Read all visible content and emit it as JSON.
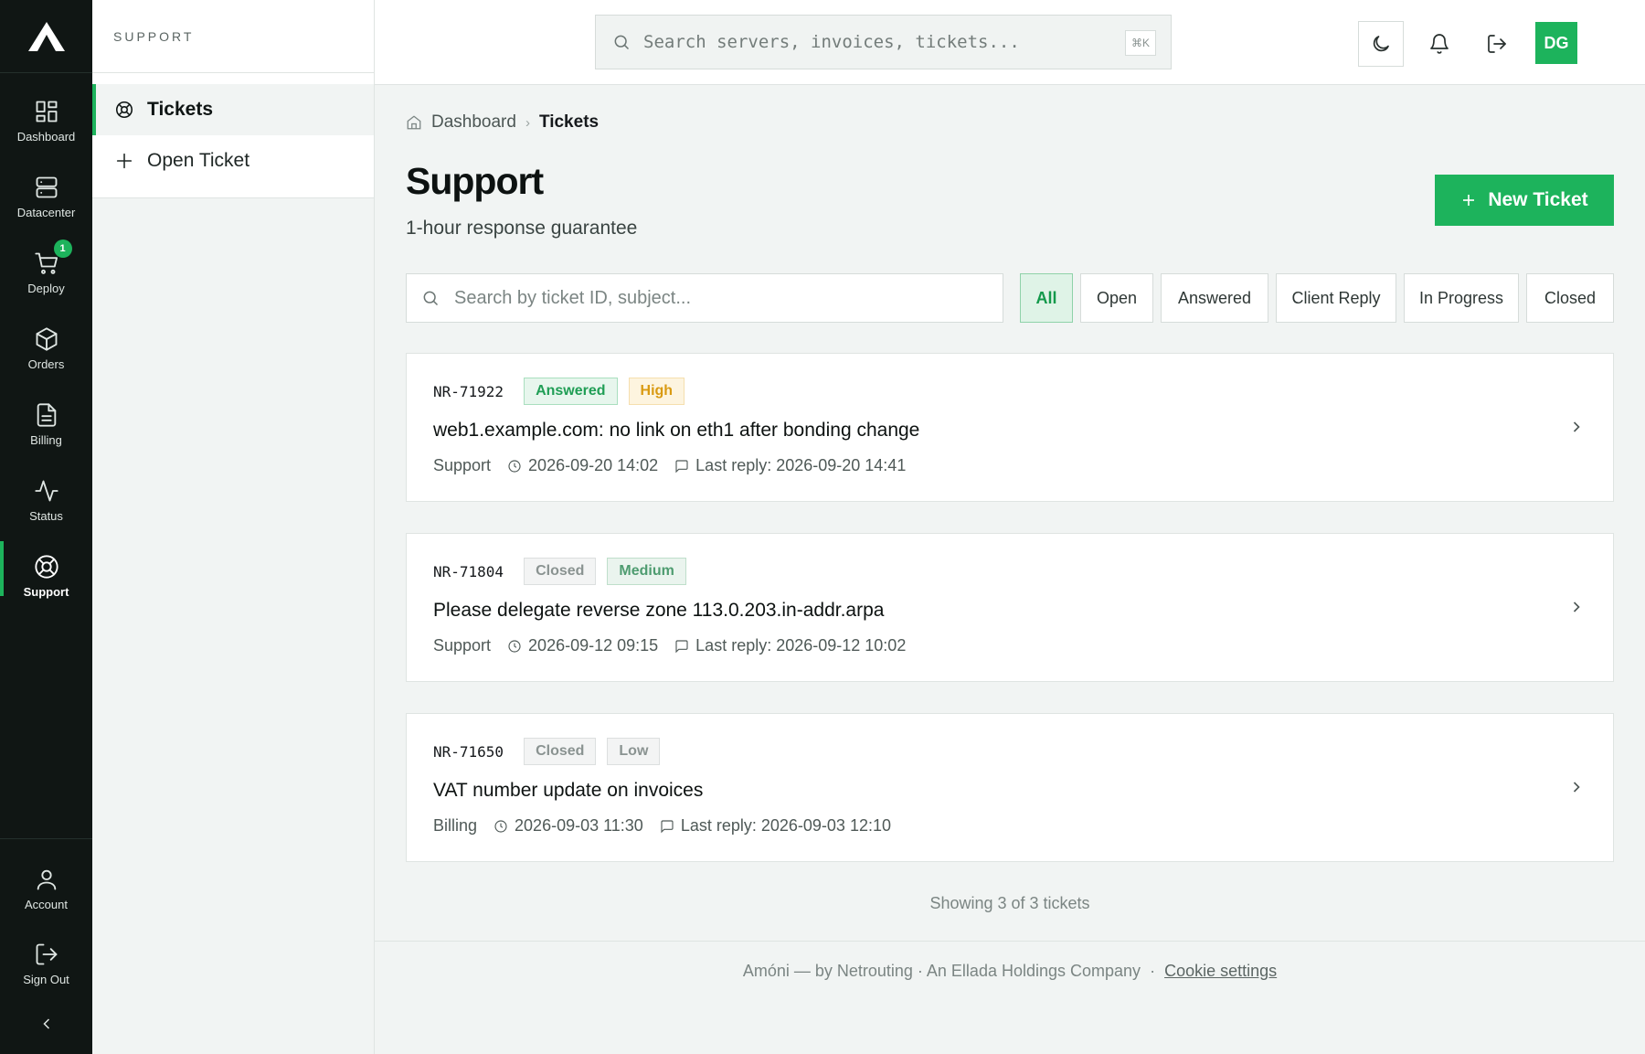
{
  "rail": {
    "items": [
      {
        "label": "Dashboard"
      },
      {
        "label": "Datacenter"
      },
      {
        "label": "Deploy",
        "badge": "1"
      },
      {
        "label": "Orders"
      },
      {
        "label": "Billing"
      },
      {
        "label": "Status"
      },
      {
        "label": "Support",
        "active": true
      }
    ],
    "bottom": [
      {
        "label": "Account"
      },
      {
        "label": "Sign Out"
      }
    ]
  },
  "subnav": {
    "heading": "SUPPORT",
    "items": [
      {
        "label": "Tickets",
        "active": true
      },
      {
        "label": "Open Ticket"
      }
    ]
  },
  "topbar": {
    "search_placeholder": "Search servers, invoices, tickets...",
    "shortcut": "⌘K",
    "avatar_initials": "DG"
  },
  "breadcrumb": {
    "home": "Dashboard",
    "separator": "›",
    "current": "Tickets"
  },
  "page": {
    "title": "Support",
    "subtitle": "1-hour response guarantee",
    "new_ticket_label": "New Ticket",
    "search_placeholder": "Search by ticket ID, subject..."
  },
  "filters": [
    "All",
    "Open",
    "Answered",
    "Client Reply",
    "In Progress",
    "Closed"
  ],
  "tickets": [
    {
      "id": "NR-71922",
      "status": "Answered",
      "priority": "High",
      "subject": "web1.example.com: no link on eth1 after bonding change",
      "department": "Support",
      "created": "2026-09-20 14:02",
      "last_reply": "Last reply: 2026-09-20 14:41"
    },
    {
      "id": "NR-71804",
      "status": "Closed",
      "priority": "Medium",
      "subject": "Please delegate reverse zone 113.0.203.in-addr.arpa",
      "department": "Support",
      "created": "2026-09-12 09:15",
      "last_reply": "Last reply: 2026-09-12 10:02"
    },
    {
      "id": "NR-71650",
      "status": "Closed",
      "priority": "Low",
      "subject": "VAT number update on invoices",
      "department": "Billing",
      "created": "2026-09-03 11:30",
      "last_reply": "Last reply: 2026-09-03 12:10"
    }
  ],
  "showing": "Showing 3 of 3 tickets",
  "footer": {
    "text": "Amóni — by Netrouting · An Ellada Holdings Company",
    "dot": "·",
    "cookie": "Cookie settings"
  },
  "colors": {
    "accent": "#1db35c",
    "rail_bg": "#101614",
    "page_bg": "#f1f4f3"
  }
}
